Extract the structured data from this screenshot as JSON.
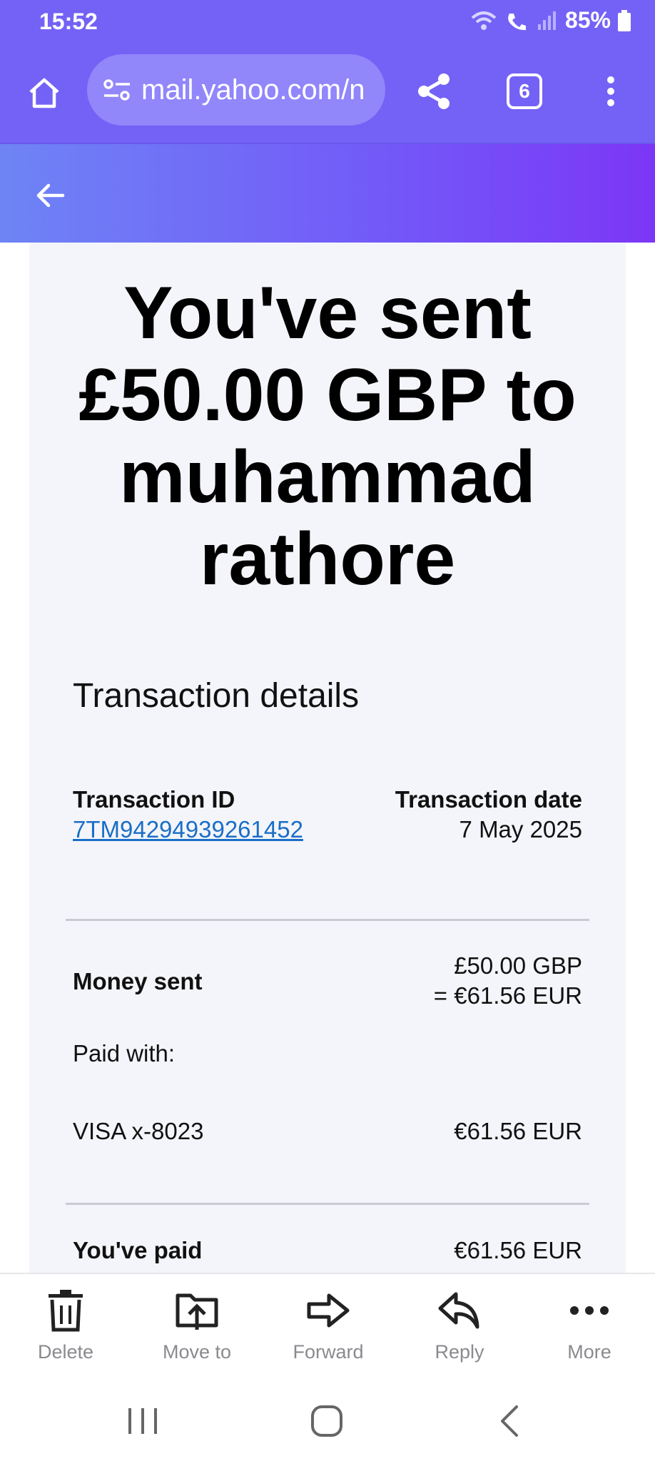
{
  "status": {
    "time": "15:52",
    "battery": "85%"
  },
  "browser": {
    "url": "mail.yahoo.com/n",
    "tab_count": "6"
  },
  "email": {
    "hero_title": "You've sent £50.00 GBP to muhammad rathore",
    "section_title": "Transaction details",
    "transaction_id_label": "Transaction ID",
    "transaction_id": "7TM94294939261452",
    "transaction_date_label": "Transaction date",
    "transaction_date": "7 May 2025",
    "money_sent_label": "Money sent",
    "money_sent_gbp": "£50.00 GBP",
    "money_sent_eur": "= €61.56 EUR",
    "paid_with_label": "Paid with:",
    "card": "VISA x-8023",
    "card_amount": "€61.56 EUR",
    "you_paid_label": "You've paid",
    "you_paid_amount": "€61.56 EUR"
  },
  "actions": [
    {
      "label": "Delete",
      "icon": "trash-icon"
    },
    {
      "label": "Move to",
      "icon": "move-folder-icon"
    },
    {
      "label": "Forward",
      "icon": "forward-arrow-icon"
    },
    {
      "label": "Reply",
      "icon": "reply-arrow-icon"
    },
    {
      "label": "More",
      "icon": "more-horizontal-icon"
    }
  ],
  "colors": {
    "accent": "#7462f6",
    "link": "#1a6ec7",
    "email_bg": "#f4f5fa"
  }
}
